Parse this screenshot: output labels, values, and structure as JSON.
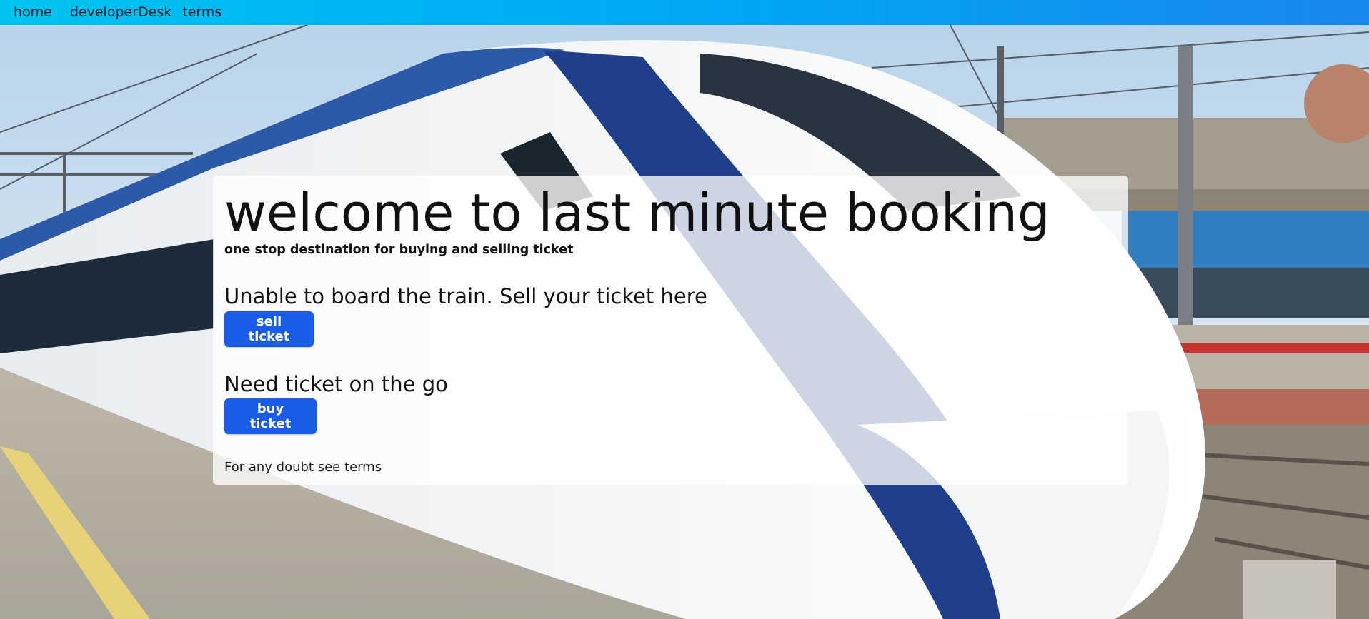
{
  "nav": {
    "home": "home",
    "developer_desk": "developerDesk",
    "terms": "terms"
  },
  "hero": {
    "title": "welcome to last minute booking",
    "subtitle": "one stop destination for buying and selling ticket",
    "sell_prompt": "Unable to board the train. Sell your ticket here",
    "sell_button": "sell ticket",
    "buy_prompt": "Need ticket on the go",
    "buy_button": "buy ticket",
    "footnote": "For any doubt see terms"
  },
  "colors": {
    "nav_gradient_start": "#00c3f0",
    "nav_gradient_end": "#1a86ef",
    "button": "#1a5ce6",
    "card_background": "rgba(255,255,255,0.78)"
  }
}
